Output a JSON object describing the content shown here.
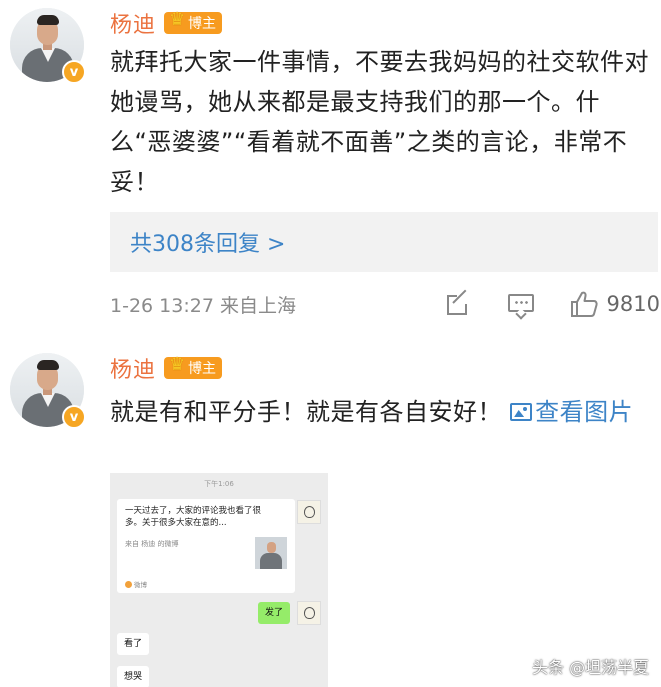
{
  "comments": [
    {
      "username": "杨迪",
      "badge": "博主",
      "verified_mark": "v",
      "text": "就拜托大家一件事情，不要去我妈妈的社交软件对她谩骂，她从来都是最支持我们的那一个。什么“恶婆婆”“看着就不面善”之类的言论，非常不妥！",
      "replies_link": "共308条回复 >",
      "time_location": "1-26 13:27 来自上海",
      "likes": "9810"
    },
    {
      "username": "杨迪",
      "badge": "博主",
      "verified_mark": "v",
      "text": "就是有和平分手！就是有各自安好！",
      "view_image_link": "查看图片"
    }
  ],
  "embedded_chat": {
    "timestamp": "下午1:06",
    "card_text": "一天过去了，大家的评论我也看了很多。关于很多大家在意的...",
    "card_source": "来自 杨迪 的微博",
    "card_footer": "微博",
    "sent_message": "发了",
    "received_messages": [
      "看了",
      "想哭"
    ]
  },
  "watermark": "头条 @坦荡半夏",
  "colors": {
    "username": "#eb7340",
    "link": "#3d84c7",
    "badge": "#f79b1f",
    "reply_box": "#f2f2f2",
    "meta_text": "#8a8a8a"
  },
  "icons": [
    "share-icon",
    "comment-icon",
    "like-icon",
    "image-icon",
    "crown-icon",
    "verified-icon"
  ]
}
